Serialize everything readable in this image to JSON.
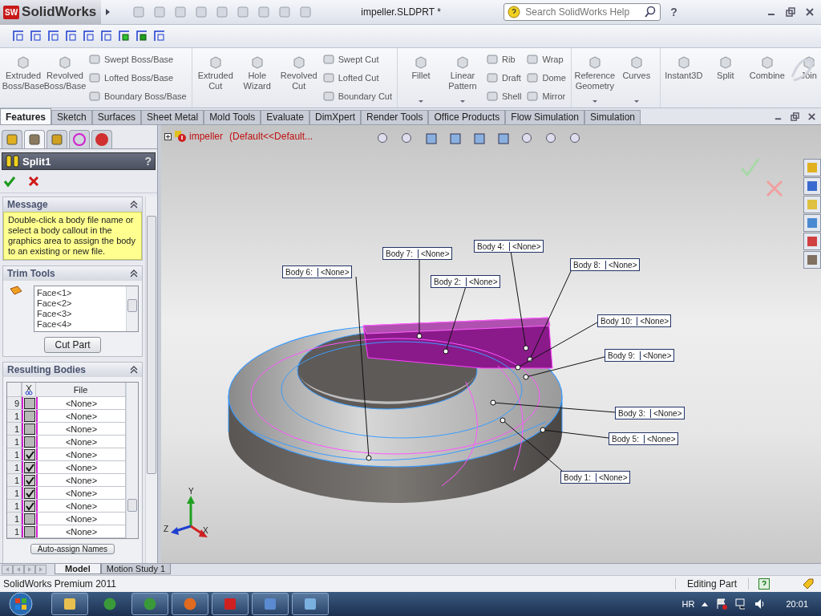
{
  "title_bar": {
    "logo_mark": "SW",
    "app_name": "SolidWorks",
    "document": "impeller.SLDPRT *",
    "search_placeholder": "Search SolidWorks Help",
    "help_mark": "?"
  },
  "ribbon": {
    "groups": [
      {
        "commands": [
          {
            "kind": "large",
            "label": "Extruded Boss/Base",
            "dropdown": false
          },
          {
            "kind": "large",
            "label": "Revolved Boss/Base",
            "dropdown": false
          },
          {
            "kind": "stack",
            "items": [
              "Swept Boss/Base",
              "Lofted Boss/Base",
              "Boundary Boss/Base"
            ]
          }
        ]
      },
      {
        "commands": [
          {
            "kind": "large",
            "label": "Extruded Cut",
            "dropdown": false
          },
          {
            "kind": "large",
            "label": "Hole Wizard",
            "dropdown": false
          },
          {
            "kind": "large",
            "label": "Revolved Cut",
            "dropdown": false
          },
          {
            "kind": "stack",
            "items": [
              "Swept Cut",
              "Lofted Cut",
              "Boundary Cut"
            ]
          }
        ]
      },
      {
        "commands": [
          {
            "kind": "large",
            "label": "Fillet",
            "dropdown": true
          },
          {
            "kind": "large",
            "label": "Linear Pattern",
            "dropdown": true
          },
          {
            "kind": "stack",
            "items": [
              "Rib",
              "Draft",
              "Shell"
            ]
          },
          {
            "kind": "stack",
            "items": [
              "Wrap",
              "Dome",
              "Mirror"
            ]
          }
        ]
      },
      {
        "commands": [
          {
            "kind": "large",
            "label": "Reference Geometry",
            "dropdown": true
          },
          {
            "kind": "large",
            "label": "Curves",
            "dropdown": true
          }
        ]
      },
      {
        "commands": [
          {
            "kind": "large",
            "label": "Instant3D",
            "dropdown": false
          },
          {
            "kind": "large",
            "label": "Split",
            "dropdown": false
          },
          {
            "kind": "large",
            "label": "Combine",
            "dropdown": false
          },
          {
            "kind": "large",
            "label": "Join",
            "dropdown": false
          }
        ]
      }
    ]
  },
  "command_tabs": [
    {
      "label": "Features",
      "selected": true
    },
    {
      "label": "Sketch",
      "selected": false
    },
    {
      "label": "Surfaces",
      "selected": false
    },
    {
      "label": "Sheet Metal",
      "selected": false
    },
    {
      "label": "Mold Tools",
      "selected": false
    },
    {
      "label": "Evaluate",
      "selected": false
    },
    {
      "label": "DimXpert",
      "selected": false
    },
    {
      "label": "Render Tools",
      "selected": false
    },
    {
      "label": "Office Products",
      "selected": false
    },
    {
      "label": "Flow Simulation",
      "selected": false
    },
    {
      "label": "Simulation",
      "selected": false
    }
  ],
  "property_manager": {
    "panel_tabs": [
      {
        "kind": "feature_tree",
        "selected": false
      },
      {
        "kind": "property_manager",
        "selected": true
      },
      {
        "kind": "configuration",
        "selected": false
      },
      {
        "kind": "dimxpert",
        "selected": false
      },
      {
        "kind": "display",
        "selected": false
      }
    ],
    "title": "Split1",
    "help": "?",
    "message": {
      "heading": "Message",
      "text": "Double-click a body file name or select a body callout in the graphics area to assign the body to an existing or new file."
    },
    "trim_tools": {
      "heading": "Trim Tools",
      "faces": [
        "Face<1>",
        "Face<2>",
        "Face<3>",
        "Face<4>"
      ],
      "button": "Cut Part"
    },
    "resulting_bodies": {
      "heading": "Resulting Bodies",
      "file_column": "File",
      "button": "Auto-assign Names",
      "rows": [
        {
          "count": "9",
          "checked": false,
          "file": "<None>"
        },
        {
          "count": "1",
          "checked": false,
          "file": "<None>"
        },
        {
          "count": "1",
          "checked": false,
          "file": "<None>"
        },
        {
          "count": "1",
          "checked": false,
          "file": "<None>"
        },
        {
          "count": "1",
          "checked": true,
          "file": "<None>"
        },
        {
          "count": "1",
          "checked": true,
          "file": "<None>"
        },
        {
          "count": "1",
          "checked": true,
          "file": "<None>"
        },
        {
          "count": "1",
          "checked": true,
          "file": "<None>"
        },
        {
          "count": "1",
          "checked": true,
          "file": "<None>"
        },
        {
          "count": "1",
          "checked": false,
          "file": "<None>"
        },
        {
          "count": "1",
          "checked": false,
          "file": "<None>"
        }
      ]
    }
  },
  "viewport": {
    "tree_item": "impeller",
    "tree_item_config": "(Default<<Default...",
    "callouts": [
      {
        "label": "Body 4:",
        "file": "<None>"
      },
      {
        "label": "Body 7:",
        "file": "<None>"
      },
      {
        "label": "Body 8:",
        "file": "<None>"
      },
      {
        "label": "Body 6:",
        "file": "<None>"
      },
      {
        "label": "Body 2:",
        "file": "<None>"
      },
      {
        "label": "Body 10:",
        "file": "<None>"
      },
      {
        "label": "Body 9:",
        "file": "<None>"
      },
      {
        "label": "Body 3:",
        "file": "<None>"
      },
      {
        "label": "Body 5:",
        "file": "<None>"
      },
      {
        "label": "Body 1:",
        "file": "<None>"
      }
    ],
    "triad": {
      "y": "Y",
      "z": "Z",
      "x": "X"
    }
  },
  "bottom_tabs": [
    {
      "label": "Model",
      "selected": true
    },
    {
      "label": "Motion Study 1",
      "selected": false
    }
  ],
  "status_bar": {
    "product": "SolidWorks Premium 2011",
    "mode": "Editing Part"
  },
  "taskbar": {
    "language": "HR",
    "clock": "20:01",
    "apps": [
      {
        "kind": "explorer",
        "running": true
      },
      {
        "kind": "chrome",
        "running": false
      },
      {
        "kind": "chrome",
        "running": true
      },
      {
        "kind": "firefox",
        "running": true
      },
      {
        "kind": "solidworks",
        "running": true
      },
      {
        "kind": "paint",
        "running": true
      },
      {
        "kind": "window",
        "running": true
      }
    ]
  }
}
